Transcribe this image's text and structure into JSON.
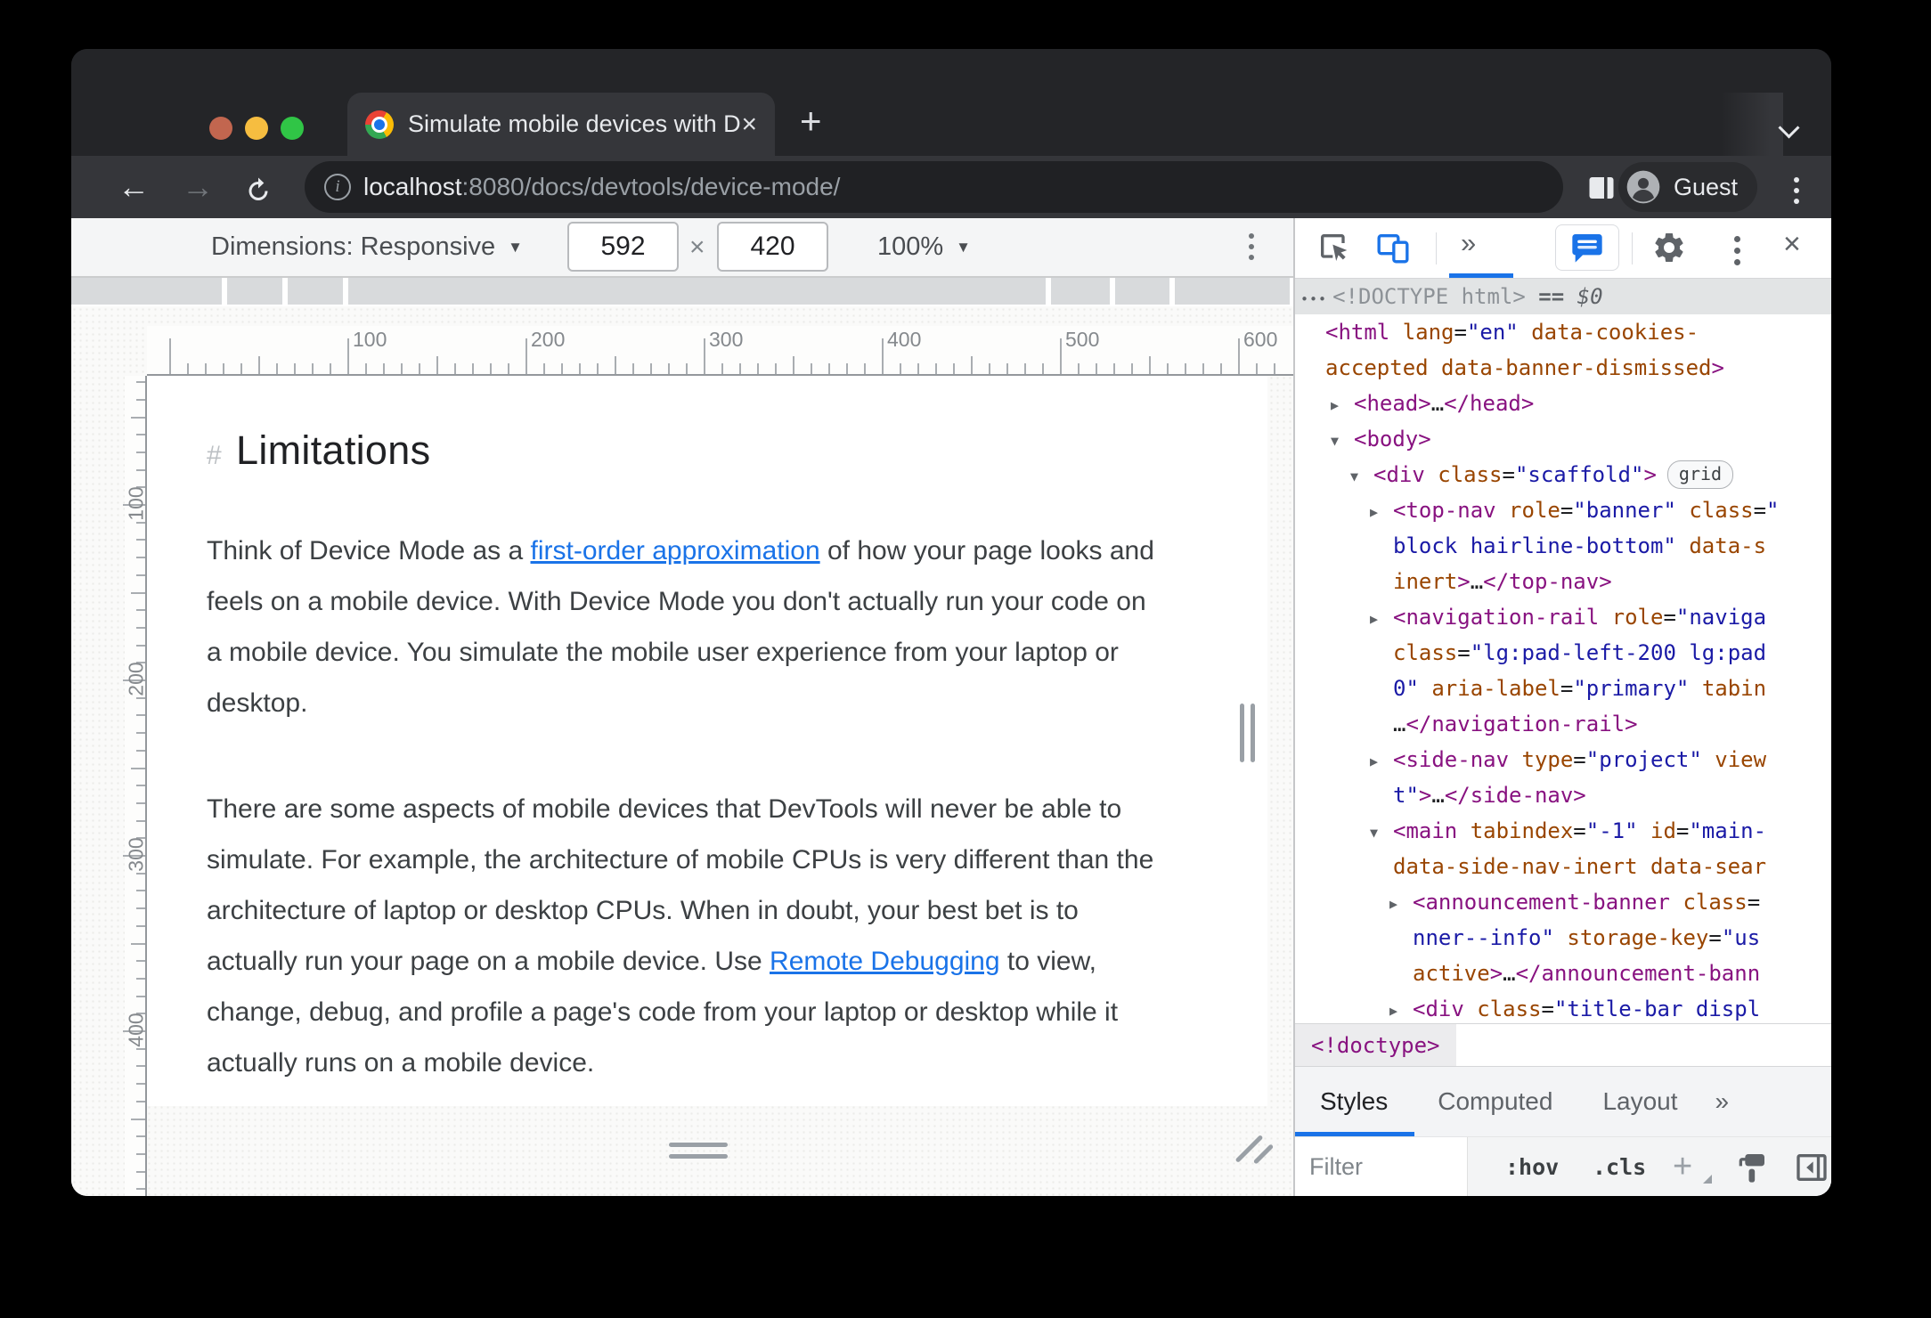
{
  "browser": {
    "tab": {
      "title": "Simulate mobile devices with D",
      "close": "×"
    },
    "new_tab": "+",
    "nav": {
      "back": "←",
      "forward": "→"
    },
    "omnibox": {
      "host": "localhost",
      "rest": ":8080/docs/devtools/device-mode/"
    },
    "profile": "Guest"
  },
  "device_toolbar": {
    "dimensions": "Dimensions: Responsive",
    "caret": "▼",
    "width": "592",
    "multiply": "×",
    "height": "420",
    "zoom": "100%"
  },
  "rulers": {
    "h_labels": [
      100,
      200,
      300,
      400,
      500,
      600
    ],
    "v_labels": [
      100,
      200,
      300,
      400
    ]
  },
  "page": {
    "hash": "#",
    "title": "Limitations",
    "paragraphs": [
      {
        "before": "Think of Device Mode as a ",
        "link": "first-order approximation",
        "after": " of how your page looks and feels on a mobile device. With Device Mode you don't actually run your code on a mobile device. You simulate the mobile user experience from your laptop or desktop."
      },
      {
        "before": "There are some aspects of mobile devices that DevTools will never be able to simulate. For example, the architecture of mobile CPUs is very different than the architecture of laptop or desktop CPUs. When in doubt, your best bet is to actually run your page on a mobile device. Use ",
        "link": "Remote Debugging",
        "after": " to view, change, debug, and profile a page's code from your laptop or desktop while it actually runs on a mobile device."
      }
    ]
  },
  "devtools": {
    "toolbar": {
      "more": "»",
      "close": "×"
    },
    "dom_lines": [
      {
        "pad": 6,
        "sel": true,
        "dots": "•••",
        "tokens": [
          [
            "gy",
            "<!DOCTYPE html>"
          ],
          [
            "pl",
            " "
          ],
          [
            "eq",
            "=="
          ],
          [
            "pl",
            " "
          ],
          [
            "dv",
            "$0"
          ]
        ]
      },
      {
        "pad": 34,
        "tokens": [
          [
            "tg",
            "<html "
          ],
          [
            "at",
            "lang"
          ],
          [
            "pl",
            "="
          ],
          [
            "vl",
            "\"en\""
          ],
          [
            "pl",
            " "
          ],
          [
            "at",
            "data-cookies-"
          ]
        ]
      },
      {
        "pad": 34,
        "tokens": [
          [
            "at",
            "accepted "
          ],
          [
            "at",
            "data-banner-dismissed"
          ],
          [
            "tg",
            ">"
          ]
        ]
      },
      {
        "pad": 40,
        "arrow": "r",
        "tokens": [
          [
            "tg",
            "<head>"
          ],
          [
            "pl",
            "…"
          ],
          [
            "tg",
            "</head>"
          ]
        ]
      },
      {
        "pad": 40,
        "arrow": "d",
        "tokens": [
          [
            "tg",
            "<body>"
          ]
        ]
      },
      {
        "pad": 62,
        "arrow": "d",
        "badge": "grid",
        "tokens": [
          [
            "tg",
            "<div "
          ],
          [
            "at",
            "class"
          ],
          [
            "pl",
            "="
          ],
          [
            "vl",
            "\"scaffold\""
          ],
          [
            "tg",
            ">"
          ]
        ]
      },
      {
        "pad": 84,
        "arrow": "r",
        "tokens": [
          [
            "tg",
            "<top-nav "
          ],
          [
            "at",
            "role"
          ],
          [
            "pl",
            "="
          ],
          [
            "vl",
            "\"banner\""
          ],
          [
            "pl",
            " "
          ],
          [
            "at",
            "class"
          ],
          [
            "pl",
            "="
          ],
          [
            "vl",
            "\""
          ]
        ]
      },
      {
        "pad": 110,
        "tokens": [
          [
            "vl",
            "block hairline-bottom\""
          ],
          [
            "pl",
            " "
          ],
          [
            "at",
            "data-s"
          ]
        ]
      },
      {
        "pad": 110,
        "tokens": [
          [
            "at",
            "inert"
          ],
          [
            "tg",
            ">"
          ],
          [
            "pl",
            "…"
          ],
          [
            "tg",
            "</top-nav>"
          ]
        ]
      },
      {
        "pad": 84,
        "arrow": "r",
        "tokens": [
          [
            "tg",
            "<navigation-rail "
          ],
          [
            "at",
            "role"
          ],
          [
            "pl",
            "="
          ],
          [
            "vl",
            "\"naviga"
          ]
        ]
      },
      {
        "pad": 110,
        "tokens": [
          [
            "at",
            "class"
          ],
          [
            "pl",
            "="
          ],
          [
            "vl",
            "\"lg:pad-left-200 lg:pad"
          ]
        ]
      },
      {
        "pad": 110,
        "tokens": [
          [
            "vl",
            "0\""
          ],
          [
            "pl",
            " "
          ],
          [
            "at",
            "aria-label"
          ],
          [
            "pl",
            "="
          ],
          [
            "vl",
            "\"primary\""
          ],
          [
            "pl",
            " "
          ],
          [
            "at",
            "tabin"
          ]
        ]
      },
      {
        "pad": 110,
        "tokens": [
          [
            "pl",
            "…"
          ],
          [
            "tg",
            "</navigation-rail>"
          ]
        ]
      },
      {
        "pad": 84,
        "arrow": "r",
        "tokens": [
          [
            "tg",
            "<side-nav "
          ],
          [
            "at",
            "type"
          ],
          [
            "pl",
            "="
          ],
          [
            "vl",
            "\"project\""
          ],
          [
            "pl",
            " "
          ],
          [
            "at",
            "view"
          ]
        ]
      },
      {
        "pad": 110,
        "tokens": [
          [
            "vl",
            "t\""
          ],
          [
            "tg",
            ">"
          ],
          [
            "pl",
            "…"
          ],
          [
            "tg",
            "</side-nav>"
          ]
        ]
      },
      {
        "pad": 84,
        "arrow": "d",
        "tokens": [
          [
            "tg",
            "<main "
          ],
          [
            "at",
            "tabindex"
          ],
          [
            "pl",
            "="
          ],
          [
            "vl",
            "\"-1\""
          ],
          [
            "pl",
            " "
          ],
          [
            "at",
            "id"
          ],
          [
            "pl",
            "="
          ],
          [
            "vl",
            "\"main-"
          ]
        ]
      },
      {
        "pad": 110,
        "tokens": [
          [
            "at",
            "data-side-nav-inert "
          ],
          [
            "at",
            "data-sear"
          ]
        ]
      },
      {
        "pad": 106,
        "arrow": "r",
        "tokens": [
          [
            "tg",
            "<announcement-banner "
          ],
          [
            "at",
            "class"
          ],
          [
            "pl",
            "="
          ]
        ]
      },
      {
        "pad": 132,
        "tokens": [
          [
            "vl",
            "nner--info\""
          ],
          [
            "pl",
            " "
          ],
          [
            "at",
            "storage-key"
          ],
          [
            "pl",
            "="
          ],
          [
            "vl",
            "\"us"
          ]
        ]
      },
      {
        "pad": 132,
        "tokens": [
          [
            "at",
            "active"
          ],
          [
            "tg",
            ">"
          ],
          [
            "pl",
            "…"
          ],
          [
            "tg",
            "</announcement-bann"
          ]
        ]
      },
      {
        "pad": 106,
        "arrow": "r",
        "tokens": [
          [
            "tg",
            "<div "
          ],
          [
            "at",
            "class"
          ],
          [
            "pl",
            "="
          ],
          [
            "vl",
            "\"title-bar displ"
          ]
        ]
      }
    ],
    "breadcrumb": "<!doctype>",
    "panel_tabs": [
      "Styles",
      "Computed",
      "Layout"
    ],
    "panel_more": "»",
    "styles_bar": {
      "filter_placeholder": "Filter",
      "hov": ":hov",
      "cls": ".cls",
      "add": "+"
    }
  },
  "colors": {
    "accent_blue": "#1a73e8",
    "tag_purple": "#881280",
    "attr_orange": "#994500",
    "value_blue": "#1a1aa6",
    "link_blue": "#1a73e8"
  }
}
